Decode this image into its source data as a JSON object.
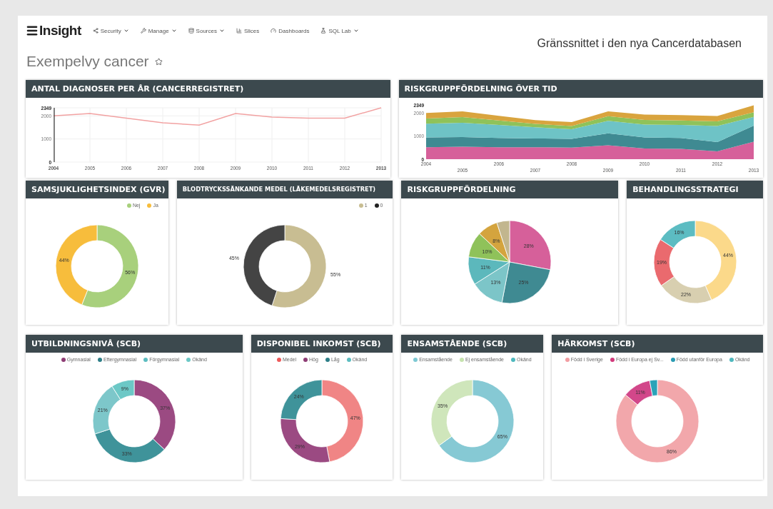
{
  "caption": "Gränssnittet i den nya Cancerdatabasen",
  "nav": {
    "logo": "Insight",
    "items": [
      {
        "label": "Security",
        "dropdown": true
      },
      {
        "label": "Manage",
        "dropdown": true
      },
      {
        "label": "Sources",
        "dropdown": true
      },
      {
        "label": "Slices",
        "dropdown": false
      },
      {
        "label": "Dashboards",
        "dropdown": false
      },
      {
        "label": "SQL Lab",
        "dropdown": true
      }
    ]
  },
  "dashboard": {
    "title": "Exempelvy cancer",
    "starred": false
  },
  "rows": [
    [
      {
        "title": "ANTAL DIAGNOSER PER ÅR (CANCERREGISTRET)",
        "chart_data": {
          "type": "line",
          "grid": true,
          "x": [
            2004,
            2005,
            2006,
            2007,
            2008,
            2009,
            2010,
            2011,
            2012,
            2013
          ],
          "series": [
            {
              "color": "#f2a2a2",
              "values": [
                2000,
                2100,
                1900,
                1700,
                1600,
                2100,
                1950,
                1900,
                1900,
                2349
              ]
            }
          ],
          "ylim": [
            0,
            2349
          ],
          "yticks": [
            0,
            1000,
            2000,
            2349
          ]
        }
      },
      {
        "title": "RISKGRUPPFÖRDELNING ÖVER TID",
        "chart_data": {
          "type": "area",
          "stacked": true,
          "x": [
            2004,
            2005,
            2006,
            2007,
            2008,
            2009,
            2010,
            2011,
            2012,
            2013
          ],
          "series": [
            {
              "color": "#d6609a",
              "values": [
                520,
                540,
                520,
                520,
                500,
                600,
                460,
                450,
                340,
                760
              ]
            },
            {
              "color": "#3f8a92",
              "values": [
                420,
                420,
                400,
                380,
                380,
                520,
                480,
                470,
                400,
                690
              ]
            },
            {
              "color": "#6ec3c6",
              "values": [
                600,
                620,
                560,
                480,
                420,
                540,
                560,
                560,
                700,
                380
              ]
            },
            {
              "color": "#8fc25a",
              "values": [
                220,
                240,
                200,
                150,
                140,
                200,
                200,
                200,
                200,
                200
              ]
            },
            {
              "color": "#d9a43e",
              "values": [
                240,
                250,
                200,
                160,
                170,
                210,
                230,
                230,
                230,
                300
              ]
            }
          ],
          "ylim": [
            0,
            2349
          ],
          "yticks": [
            0,
            1000,
            2000,
            2349
          ]
        }
      }
    ],
    [
      {
        "title": "SAMSJUKLIGHETSINDEX (GVR)",
        "legend": [
          {
            "label": "Nej",
            "color": "#a8d07c"
          },
          {
            "label": "Ja",
            "color": "#f7bd3c"
          }
        ],
        "chart_data": {
          "type": "donut",
          "values": [
            56,
            44
          ],
          "colors": [
            "#a8d07c",
            "#f7bd3c"
          ],
          "value_labels": [
            "56%",
            "44%"
          ]
        }
      },
      {
        "title": "BLODTRYCKSSÄNKANDE MEDEL (LÄKEMEDELSREGISTRET)",
        "legend": [
          {
            "label": "1",
            "color": "#c8bd92"
          },
          {
            "label": "0",
            "color": "#222222"
          }
        ],
        "chart_data": {
          "type": "donut",
          "values": [
            55,
            45
          ],
          "colors": [
            "#c8bd92",
            "#444444"
          ],
          "value_labels": [
            "55%",
            "45%"
          ]
        }
      },
      {
        "title": "RISKGRUPPFÖRDELNING",
        "chart_data": {
          "type": "pie",
          "values": [
            28,
            25,
            13,
            11,
            10,
            8,
            5
          ],
          "colors": [
            "#d6609a",
            "#3f8a92",
            "#7cc5c8",
            "#5cb8bc",
            "#8fc25a",
            "#d4a43e",
            "#c2b68e"
          ],
          "value_labels": [
            "28%",
            "25%",
            "13%",
            "11%",
            "10%",
            "8%",
            null
          ]
        }
      },
      {
        "title": "BEHANDLINGSSTRATEGI",
        "chart_data": {
          "type": "donut",
          "values": [
            44,
            22,
            19,
            16
          ],
          "colors": [
            "#fbd98a",
            "#d8cfb0",
            "#ea6a6e",
            "#5cbcc2"
          ],
          "value_labels": [
            "44%",
            "22%",
            "19%",
            "16%"
          ]
        }
      }
    ],
    [
      {
        "title": "UTBILDNINGSNIVÅ (SCB)",
        "legend": [
          {
            "label": "Gymnasial",
            "color": "#8e3d75"
          },
          {
            "label": "Eftergymnasial",
            "color": "#2d7f88"
          },
          {
            "label": "Förgymnasial",
            "color": "#5cbdc1"
          },
          {
            "label": "Okänd",
            "color": "#6cc8c6"
          }
        ],
        "chart_data": {
          "type": "donut",
          "values": [
            37,
            33,
            21,
            9
          ],
          "colors": [
            "#9b4a82",
            "#3f939a",
            "#7dc7ca",
            "#6cc8c6"
          ],
          "value_labels": [
            "37%",
            "33%",
            "21%",
            "9%"
          ]
        }
      },
      {
        "title": "DISPONIBEL INKOMST (SCB)",
        "legend": [
          {
            "label": "Medel",
            "color": "#ee5a5a"
          },
          {
            "label": "Hög",
            "color": "#8e3d75"
          },
          {
            "label": "Låg",
            "color": "#2d7f88"
          },
          {
            "label": "Okänd",
            "color": "#5cbdc1"
          }
        ],
        "chart_data": {
          "type": "donut",
          "values": [
            47,
            29,
            24
          ],
          "colors": [
            "#f08585",
            "#9b4a82",
            "#3f939a"
          ],
          "value_labels": [
            "47%",
            "29%",
            "24%"
          ]
        }
      },
      {
        "title": "ENSAMSTÅENDE (SCB)",
        "legend": [
          {
            "label": "Ensamstående",
            "color": "#7ec9d4"
          },
          {
            "label": "Ej ensamstående",
            "color": "#c6e3ae"
          },
          {
            "label": "Okänd",
            "color": "#4fb8be"
          }
        ],
        "chart_data": {
          "type": "donut",
          "values": [
            65,
            35
          ],
          "colors": [
            "#86c9d4",
            "#cfe6bb"
          ],
          "value_labels": [
            "65%",
            "35%"
          ]
        }
      },
      {
        "title": "HÄRKOMST (SCB)",
        "legend": [
          {
            "label": "Född i Sverige",
            "color": "#f29da2"
          },
          {
            "label": "Född i Europa ej Sv...",
            "color": "#d23a7c"
          },
          {
            "label": "Född utanför Europa",
            "color": "#2a9bb3"
          },
          {
            "label": "Okänd",
            "color": "#4fb8be"
          }
        ],
        "chart_data": {
          "type": "donut",
          "values": [
            86,
            11,
            3
          ],
          "colors": [
            "#f2a7ab",
            "#d2478a",
            "#2aa3b8"
          ],
          "value_labels": [
            "86%",
            "11%",
            null
          ]
        }
      }
    ]
  ]
}
